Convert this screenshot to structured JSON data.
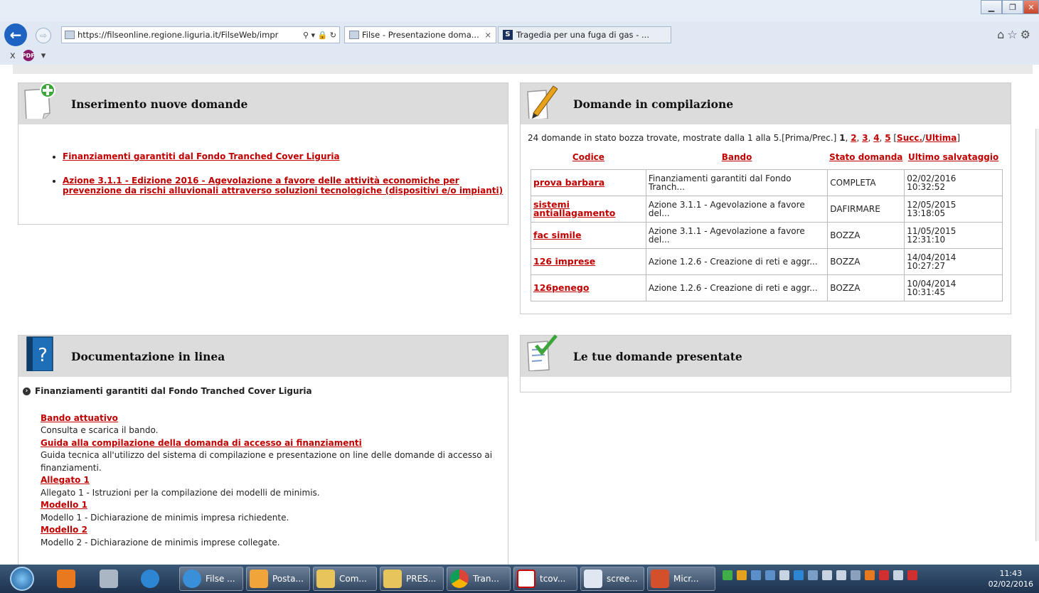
{
  "browser": {
    "url": "https://filseonline.regione.liguria.it/FilseWeb/impr",
    "tabs": [
      {
        "label": "Filse - Presentazione doma...",
        "close": "×"
      },
      {
        "label": "Tragedia per una fuga di gas - ..."
      }
    ],
    "cmd_close": "x"
  },
  "insert_panel": {
    "title": "Inserimento nuove domande",
    "links": [
      "Finanziamenti garantiti dal Fondo Tranched Cover Liguria",
      "Azione 3.1.1 - Edizione 2016 - Agevolazione a favore delle attività economiche per prevenzione da rischi alluvionali attraverso soluzioni tecnologiche (dispositivi e/o impianti)"
    ]
  },
  "draft_panel": {
    "title": "Domande in compilazione",
    "summary": "24 domande in stato bozza trovate, mostrate dalla 1 alla 5.[Prima/Prec.]",
    "pages": [
      "1",
      "2",
      "3",
      "4",
      "5"
    ],
    "next": "Succ.",
    "last": "Ultima",
    "headers": {
      "code": "Codice",
      "bando": "Bando",
      "stato": "Stato domanda",
      "saved": "Ultimo salvataggio"
    },
    "rows": [
      {
        "code": "prova barbara",
        "bando": "Finanziamenti garantiti dal Fondo Tranch...",
        "stato": "COMPLETA",
        "date": "02/02/2016",
        "time": "10:32:52"
      },
      {
        "code": "sistemi antiallagamento",
        "bando": "Azione 3.1.1 - Agevolazione a favore del...",
        "stato": "DAFIRMARE",
        "date": "12/05/2015",
        "time": "13:18:05"
      },
      {
        "code": "fac simile",
        "bando": "Azione 3.1.1 - Agevolazione a favore del...",
        "stato": "BOZZA",
        "date": "11/05/2015",
        "time": "12:31:10"
      },
      {
        "code": "126 imprese",
        "bando": "Azione 1.2.6 - Creazione di reti e aggr...",
        "stato": "BOZZA",
        "date": "14/04/2014",
        "time": "10:27:27"
      },
      {
        "code": "126penego",
        "bando": "Azione 1.2.6 - Creazione di reti e aggr...",
        "stato": "BOZZA",
        "date": "10/04/2014",
        "time": "10:31:45"
      }
    ]
  },
  "doc_panel": {
    "title": "Documentazione in linea",
    "section": "Finanziamenti garantiti dal Fondo Tranched Cover Liguria",
    "items": [
      {
        "link": "Bando attuativo",
        "desc": "Consulta e scarica il bando."
      },
      {
        "link": "Guida alla compilazione della domanda di accesso ai finanziamenti",
        "desc": "Guida tecnica all'utilizzo del sistema di compilazione e presentazione on line delle domande di accesso ai finanziamenti."
      },
      {
        "link": "Allegato 1",
        "desc": "Allegato 1 - Istruzioni per la compilazione dei modelli de minimis."
      },
      {
        "link": "Modello 1",
        "desc": "Modello 1 - Dichiarazione de minimis impresa richiedente."
      },
      {
        "link": "Modello 2",
        "desc": "Modello 2 - Dichiarazione de minimis imprese collegate."
      }
    ]
  },
  "submitted_panel": {
    "title": "Le tue domande presentate"
  },
  "taskbar": {
    "items": [
      "Filse ...",
      "Posta...",
      "Com...",
      "PRES...",
      "Tran...",
      "tcov...",
      "scree...",
      "Micr..."
    ],
    "time": "11:43",
    "date": "02/02/2016"
  }
}
